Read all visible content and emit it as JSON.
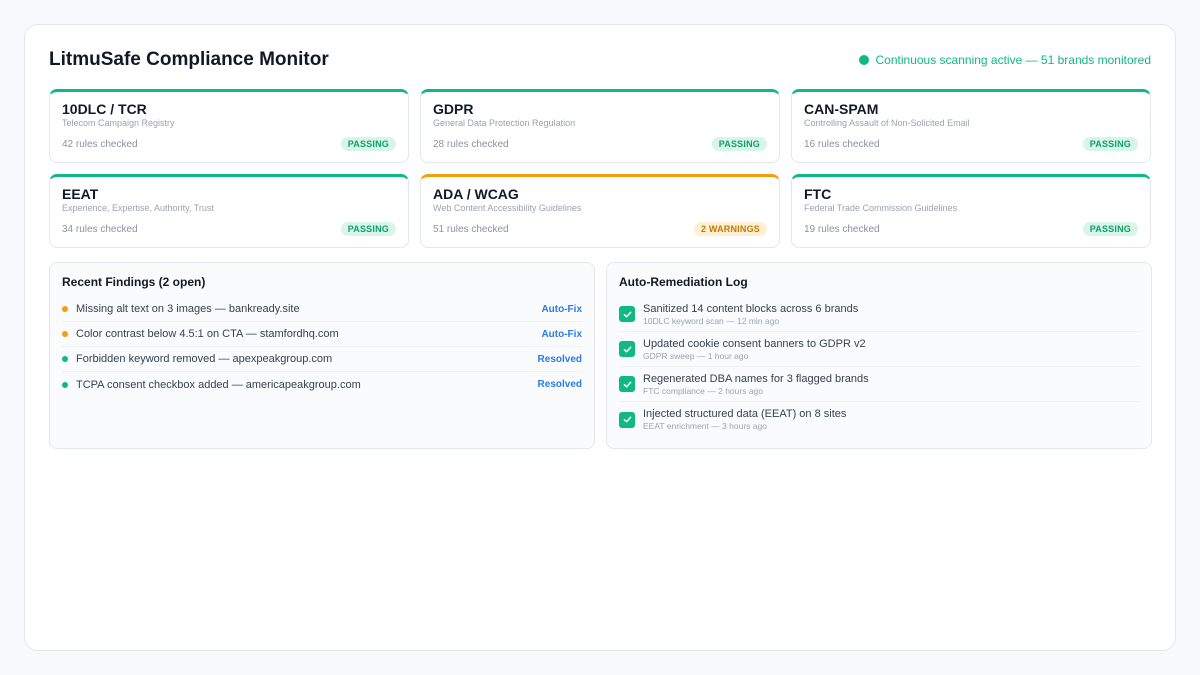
{
  "header": {
    "title": "LitmuSafe Compliance Monitor",
    "status": "Continuous scanning active — 51 brands monitored"
  },
  "cards": [
    {
      "name": "10DLC / TCR",
      "desc": "Telecom Campaign Registry",
      "rules": "42 rules checked",
      "badge": "PASSING"
    },
    {
      "name": "GDPR",
      "desc": "General Data Protection Regulation",
      "rules": "28 rules checked",
      "badge": "PASSING"
    },
    {
      "name": "CAN-SPAM",
      "desc": "Controlling Assault of Non-Solicited Email",
      "rules": "16 rules checked",
      "badge": "PASSING"
    },
    {
      "name": "EEAT",
      "desc": "Experience, Expertise, Authority, Trust",
      "rules": "34 rules checked",
      "badge": "PASSING"
    },
    {
      "name": "ADA / WCAG",
      "desc": "Web Content Accessibility Guidelines",
      "rules": "51 rules checked",
      "badge": "2 WARNINGS"
    },
    {
      "name": "FTC",
      "desc": "Federal Trade Commission Guidelines",
      "rules": "19 rules checked",
      "badge": "PASSING"
    }
  ],
  "findings": {
    "title": "Recent Findings (2 open)",
    "items": [
      {
        "text": "Missing alt text on 3 images — bankready.site",
        "action": "Auto-Fix"
      },
      {
        "text": "Color contrast below 4.5:1 on CTA — stamfordhq.com",
        "action": "Auto-Fix"
      },
      {
        "text": "Forbidden keyword removed — apexpeakgroup.com",
        "action": "Resolved"
      },
      {
        "text": "TCPA consent checkbox added — americapeakgroup.com",
        "action": "Resolved"
      }
    ]
  },
  "log": {
    "title": "Auto-Remediation Log",
    "items": [
      {
        "main": "Sanitized 14 content blocks across 6 brands",
        "sub": "10DLC keyword scan — 12 min ago"
      },
      {
        "main": "Updated cookie consent banners to GDPR v2",
        "sub": "GDPR sweep — 1 hour ago"
      },
      {
        "main": "Regenerated DBA names for 3 flagged brands",
        "sub": "FTC compliance — 2 hours ago"
      },
      {
        "main": "Injected structured data (EEAT) on 8 sites",
        "sub": "EEAT enrichment — 3 hours ago"
      }
    ]
  },
  "colors": {
    "success": "#10b981",
    "warning": "#f59e0b",
    "link": "#2b7be4"
  }
}
